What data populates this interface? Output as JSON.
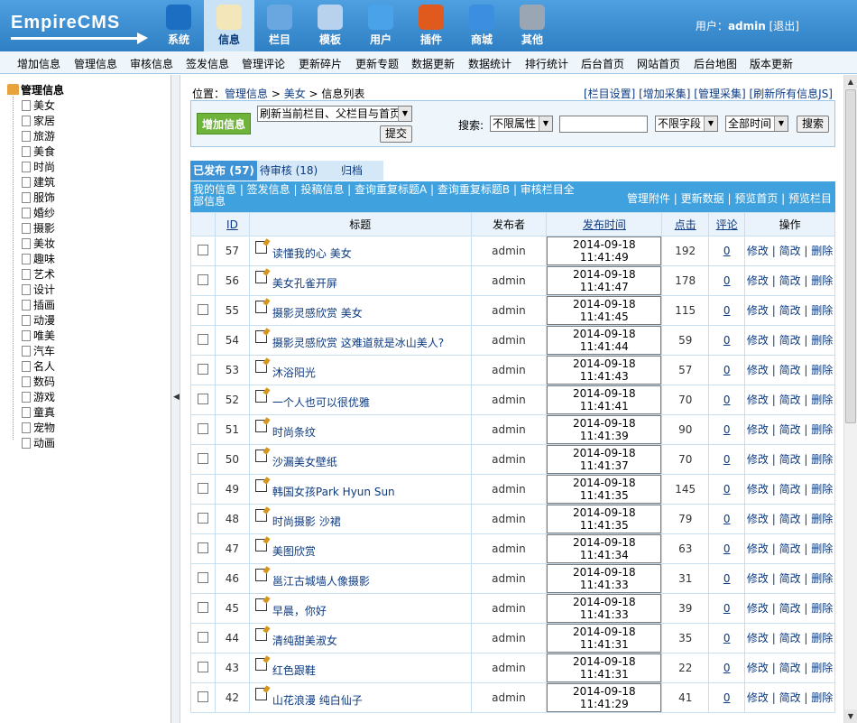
{
  "logo": {
    "text": "EmpireCMS"
  },
  "nav": [
    {
      "label": "系统",
      "icon": "globe-icon"
    },
    {
      "label": "信息",
      "icon": "edit-document-icon"
    },
    {
      "label": "栏目",
      "icon": "folder-icon"
    },
    {
      "label": "模板",
      "icon": "template-window-icon"
    },
    {
      "label": "用户",
      "icon": "user-icon"
    },
    {
      "label": "插件",
      "icon": "tools-icon"
    },
    {
      "label": "商城",
      "icon": "card-icon"
    },
    {
      "label": "其他",
      "icon": "gear-icon"
    }
  ],
  "user": {
    "prefix": "用户：",
    "name": "admin",
    "logout": "[退出]"
  },
  "menubar": [
    "增加信息",
    "管理信息",
    "审核信息",
    "签发信息",
    "管理评论",
    "更新碎片",
    "更新专题",
    "数据更新",
    "数据统计",
    "排行统计",
    "后台首页",
    "网站首页",
    "后台地图",
    "版本更新"
  ],
  "tree": {
    "root": "管理信息",
    "items": [
      "美女",
      "家居",
      "旅游",
      "美食",
      "时尚",
      "建筑",
      "服饰",
      "婚纱",
      "摄影",
      "美妆",
      "趣味",
      "艺术",
      "设计",
      "插画",
      "动漫",
      "唯美",
      "汽车",
      "名人",
      "数码",
      "游戏",
      "童真",
      "宠物",
      "动画"
    ]
  },
  "breadcrumb": {
    "prefix": "位置：",
    "path1": "管理信息",
    "sep": " > ",
    "path2": "美女",
    "path3": "信息列表"
  },
  "toplinks": "[栏目设置] [增加采集] [管理采集] [刷新所有信息JS]",
  "search": {
    "add_label": "增加信息",
    "refresh_select": "刷新当前栏目、父栏目与首页",
    "submit_label": "提交",
    "search_label": "搜索:",
    "attr_select": "不限属性",
    "keyword": "",
    "field_select": "不限字段",
    "time_select": "全部时间",
    "search_button": "搜索"
  },
  "tabs": [
    "已发布 (57)",
    "待审核 (18)",
    "归档"
  ],
  "subbar": {
    "left": "我的信息 | 签发信息 | 投稿信息 | 查询重复标题A | 查询重复标题B | 审核栏目全部信息",
    "right": "管理附件 | 更新数据 | 预览首页 | 预览栏目"
  },
  "columns": {
    "id": "ID",
    "title": "标题",
    "publisher": "发布者",
    "time": "发布时间",
    "clicks": "点击",
    "comments": "评论",
    "ops": "操作"
  },
  "ops": {
    "edit": "修改",
    "quick_edit": "简改",
    "delete": "删除"
  },
  "rows": [
    {
      "id": "57",
      "title": "读懂我的心 美女",
      "publisher": "admin",
      "time": "2014-09-18 11:41:49",
      "clicks": "192",
      "comments": "0"
    },
    {
      "id": "56",
      "title": "美女孔雀开屏",
      "publisher": "admin",
      "time": "2014-09-18 11:41:47",
      "clicks": "178",
      "comments": "0"
    },
    {
      "id": "55",
      "title": "摄影灵感欣赏 美女",
      "publisher": "admin",
      "time": "2014-09-18 11:41:45",
      "clicks": "115",
      "comments": "0"
    },
    {
      "id": "54",
      "title": "摄影灵感欣赏 这难道就是冰山美人?",
      "publisher": "admin",
      "time": "2014-09-18 11:41:44",
      "clicks": "59",
      "comments": "0"
    },
    {
      "id": "53",
      "title": "沐浴阳光",
      "publisher": "admin",
      "time": "2014-09-18 11:41:43",
      "clicks": "57",
      "comments": "0"
    },
    {
      "id": "52",
      "title": "一个人也可以很优雅",
      "publisher": "admin",
      "time": "2014-09-18 11:41:41",
      "clicks": "70",
      "comments": "0"
    },
    {
      "id": "51",
      "title": "时尚条纹",
      "publisher": "admin",
      "time": "2014-09-18 11:41:39",
      "clicks": "90",
      "comments": "0"
    },
    {
      "id": "50",
      "title": "沙漏美女壁纸",
      "publisher": "admin",
      "time": "2014-09-18 11:41:37",
      "clicks": "70",
      "comments": "0"
    },
    {
      "id": "49",
      "title": "韩国女孩Park Hyun Sun",
      "publisher": "admin",
      "time": "2014-09-18 11:41:35",
      "clicks": "145",
      "comments": "0"
    },
    {
      "id": "48",
      "title": "时尚摄影 沙裙",
      "publisher": "admin",
      "time": "2014-09-18 11:41:35",
      "clicks": "79",
      "comments": "0"
    },
    {
      "id": "47",
      "title": "美图欣赏",
      "publisher": "admin",
      "time": "2014-09-18 11:41:34",
      "clicks": "63",
      "comments": "0"
    },
    {
      "id": "46",
      "title": "邕江古城墙人像摄影",
      "publisher": "admin",
      "time": "2014-09-18 11:41:33",
      "clicks": "31",
      "comments": "0"
    },
    {
      "id": "45",
      "title": "早晨，你好",
      "publisher": "admin",
      "time": "2014-09-18 11:41:33",
      "clicks": "39",
      "comments": "0"
    },
    {
      "id": "44",
      "title": "清纯甜美淑女",
      "publisher": "admin",
      "time": "2014-09-18 11:41:31",
      "clicks": "35",
      "comments": "0"
    },
    {
      "id": "43",
      "title": "红色跟鞋",
      "publisher": "admin",
      "time": "2014-09-18 11:41:31",
      "clicks": "22",
      "comments": "0"
    },
    {
      "id": "42",
      "title": "山花浪漫 纯白仙子",
      "publisher": "admin",
      "time": "2014-09-18 11:41:29",
      "clicks": "41",
      "comments": "0"
    }
  ]
}
